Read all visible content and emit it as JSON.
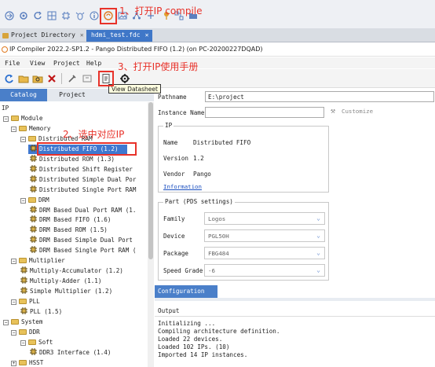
{
  "annotations": {
    "step1": "1、打开IP compile",
    "step2": "2、选中对应IP",
    "step3": "3、打开IP使用手册"
  },
  "ide_tabs": [
    {
      "label": "Project Directory",
      "close": "✕"
    },
    {
      "label": "hdmi_test.fdc",
      "close": "✕"
    }
  ],
  "window": {
    "title": "IP Compiler 2022.2-SP1.2 - Pango Distributed FIFO (1.2) (on PC-20200227DQAD)"
  },
  "menu": [
    "File",
    "View",
    "Project",
    "Help"
  ],
  "tooltip": "View Datasheet",
  "left_tabs": [
    "Catalog",
    "Project"
  ],
  "tree": [
    {
      "label": "IP",
      "level": 0,
      "kind": "root"
    },
    {
      "label": "Module",
      "level": 1,
      "kind": "folder",
      "exp": "−"
    },
    {
      "label": "Memory",
      "level": 2,
      "kind": "folder",
      "exp": "−"
    },
    {
      "label": "Distributed RAM",
      "level": 3,
      "kind": "folder",
      "exp": "−"
    },
    {
      "label": "Distributed FIFO (1.2)",
      "level": 4,
      "kind": "ip",
      "selected": true
    },
    {
      "label": "Distributed ROM (1.3)",
      "level": 4,
      "kind": "ip"
    },
    {
      "label": "Distributed Shift Register",
      "level": 4,
      "kind": "ip"
    },
    {
      "label": "Distributed Simple Dual Por",
      "level": 4,
      "kind": "ip"
    },
    {
      "label": "Distributed Single Port RAM",
      "level": 4,
      "kind": "ip"
    },
    {
      "label": "DRM",
      "level": 3,
      "kind": "folder",
      "exp": "−"
    },
    {
      "label": "DRM Based Dual Port RAM (1.",
      "level": 4,
      "kind": "ip"
    },
    {
      "label": "DRM Based FIFO (1.6)",
      "level": 4,
      "kind": "ip"
    },
    {
      "label": "DRM Based ROM (1.5)",
      "level": 4,
      "kind": "ip"
    },
    {
      "label": "DRM Based Simple Dual Port",
      "level": 4,
      "kind": "ip"
    },
    {
      "label": "DRM Based Single Port RAM (",
      "level": 4,
      "kind": "ip"
    },
    {
      "label": "Multiplier",
      "level": 2,
      "kind": "folder",
      "exp": "−"
    },
    {
      "label": "Multiply-Accumulator (1.2)",
      "level": 3,
      "kind": "ip"
    },
    {
      "label": "Multiply-Adder (1.1)",
      "level": 3,
      "kind": "ip"
    },
    {
      "label": "Simple Multiplier (1.2)",
      "level": 3,
      "kind": "ip"
    },
    {
      "label": "PLL",
      "level": 2,
      "kind": "folder",
      "exp": "−"
    },
    {
      "label": "PLL (1.5)",
      "level": 3,
      "kind": "ip"
    },
    {
      "label": "System",
      "level": 1,
      "kind": "folder",
      "exp": "−"
    },
    {
      "label": "DDR",
      "level": 2,
      "kind": "folder",
      "exp": "−"
    },
    {
      "label": "Soft",
      "level": 3,
      "kind": "folder",
      "exp": "−"
    },
    {
      "label": "DDR3 Interface (1.4)",
      "level": 4,
      "kind": "ip"
    },
    {
      "label": "HSST",
      "level": 2,
      "kind": "folder",
      "exp": "+"
    }
  ],
  "form": {
    "pathname_label": "Pathname",
    "pathname_value": "E:\\project",
    "instance_label": "Instance Name",
    "instance_value": "",
    "customize_label": "Customize",
    "ip_group": "IP",
    "name_label": "Name",
    "name_value": "Distributed FIFO",
    "version_label": "Version",
    "version_value": "1.2",
    "vendor_label": "Vendor",
    "vendor_value": "Pango",
    "information_link": "Information",
    "part_group": "Part (PDS settings)",
    "family_label": "Family",
    "family_value": "Logos",
    "device_label": "Device",
    "device_value": "PGL50H",
    "package_label": "Package",
    "package_value": "FBG484",
    "speed_label": "Speed Grade",
    "speed_value": "-6"
  },
  "config_tab": "Configuration",
  "output": {
    "title": "Output",
    "lines": [
      "Initializing ...",
      "Compiling architecture definition.",
      "Loaded 22 devices.",
      "Loaded 102 IPs. (10)",
      "Imported 14 IP instances."
    ]
  },
  "colors": {
    "annotation_red": "#e8322a",
    "selection_blue": "#3f78d0",
    "tab_blue": "#4a7fc9"
  }
}
